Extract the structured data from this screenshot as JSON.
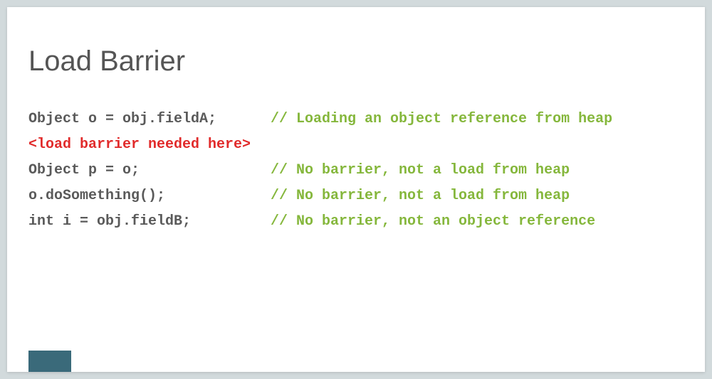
{
  "title": "Load Barrier",
  "lines": [
    {
      "code": "Object o = obj.fieldA;",
      "comment": "// Loading an object reference from heap",
      "highlight": false
    },
    {
      "code": "<load barrier needed here>",
      "comment": "",
      "highlight": true
    },
    {
      "code": "Object p = o;",
      "comment": "// No barrier, not a load from heap",
      "highlight": false
    },
    {
      "code": "o.doSomething();",
      "comment": "// No barrier, not a load from heap",
      "highlight": false
    },
    {
      "code": "int i = obj.fieldB;",
      "comment": "// No barrier, not an object reference",
      "highlight": false
    }
  ]
}
